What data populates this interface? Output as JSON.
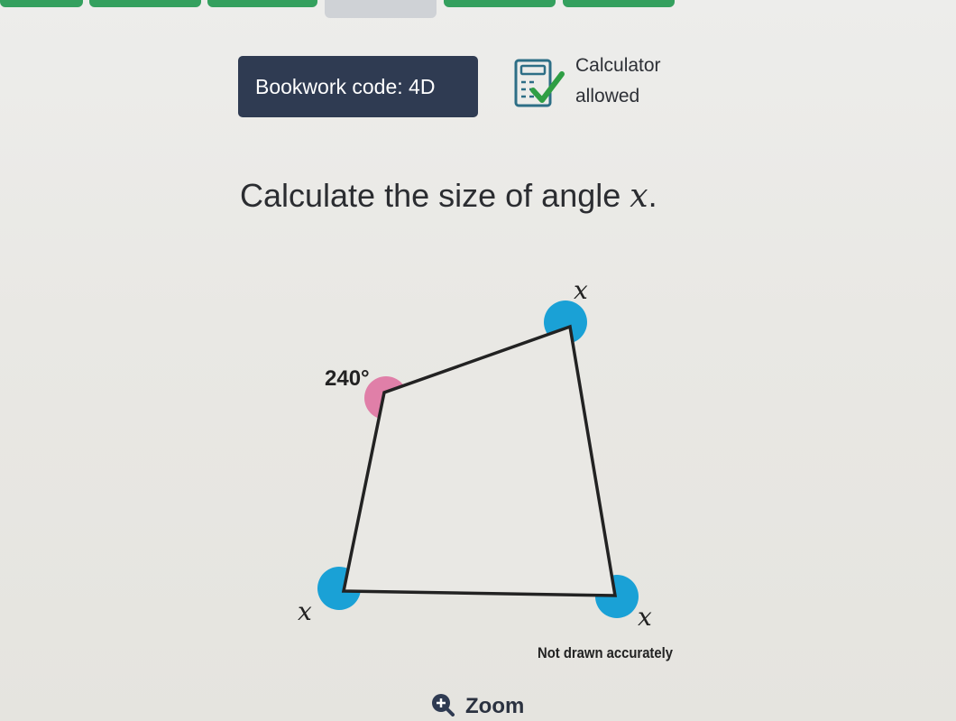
{
  "header": {
    "bookwork_code": "Bookwork code: 4D",
    "calculator_line1": "Calculator",
    "calculator_line2": "allowed"
  },
  "question": {
    "text": "Calculate the size of angle ",
    "variable": "x",
    "suffix": "."
  },
  "diagram": {
    "angle_top_right": "x",
    "angle_top_left": "240°",
    "angle_bottom_left": "x",
    "angle_bottom_right": "x",
    "note": "Not drawn accurately"
  },
  "zoom": {
    "label": "Zoom"
  },
  "colors": {
    "badge": "#2f3b52",
    "angle_x": "#1aa1d6",
    "angle_reflex": "#e07fa8",
    "check": "#2f9e44"
  }
}
